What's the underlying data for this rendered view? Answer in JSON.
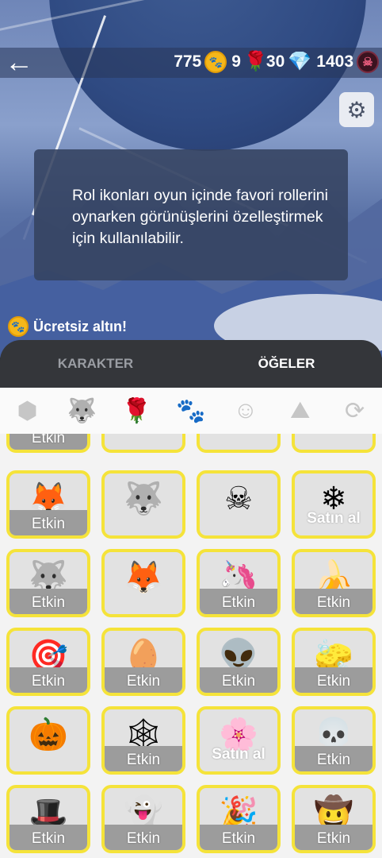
{
  "header": {
    "back_icon": "arrow-left-icon",
    "currencies": [
      {
        "value": "775",
        "icon": "coin-icon"
      },
      {
        "value": "9",
        "icon": "rose-icon"
      },
      {
        "value": "30",
        "icon": "gem-icon"
      },
      {
        "value": "1403",
        "icon": "skull-token-icon"
      }
    ]
  },
  "info_text": "Rol ikonları oyun içinde favori rollerini oynarken görünüşlerini özelleştirmek için kullanılabilir.",
  "free_gold_label": "Ücretsiz altın!",
  "tabs": [
    {
      "label": "KARAKTER",
      "active": false
    },
    {
      "label": "ÖĞELER",
      "active": true
    }
  ],
  "categories": [
    "shield-wolf-icon",
    "wolf-icon",
    "rose-icon",
    "paw-icon",
    "smile-icon",
    "landscape-icon",
    "refresh-icon"
  ],
  "items": [
    {
      "label": "Etkin",
      "icon": "🟡"
    },
    {
      "label": "",
      "icon": "🐾"
    },
    {
      "label": "",
      "icon": "🕷"
    },
    {
      "label": "",
      "icon": "🟡"
    },
    {
      "label": "Etkin",
      "icon": "🦊"
    },
    {
      "label": "",
      "icon": "🐺"
    },
    {
      "label": "",
      "icon": "☠"
    },
    {
      "label": "Satın al",
      "icon": "❄"
    },
    {
      "label": "Etkin",
      "icon": "🐺"
    },
    {
      "label": "",
      "icon": "🦊"
    },
    {
      "label": "Etkin",
      "icon": "🦄"
    },
    {
      "label": "Etkin",
      "icon": "🍌"
    },
    {
      "label": "Etkin",
      "icon": "🎯"
    },
    {
      "label": "Etkin",
      "icon": "🥚"
    },
    {
      "label": "Etkin",
      "icon": "👽"
    },
    {
      "label": "Etkin",
      "icon": "🧽"
    },
    {
      "label": "",
      "icon": "🎃"
    },
    {
      "label": "Etkin",
      "icon": "🕸"
    },
    {
      "label": "Satın al",
      "icon": "🌸"
    },
    {
      "label": "Etkin",
      "icon": "💀"
    },
    {
      "label": "Etkin",
      "icon": "🎩"
    },
    {
      "label": "Etkin",
      "icon": "👻"
    },
    {
      "label": "Etkin",
      "icon": "🎉"
    },
    {
      "label": "Etkin",
      "icon": "🤠"
    }
  ]
}
